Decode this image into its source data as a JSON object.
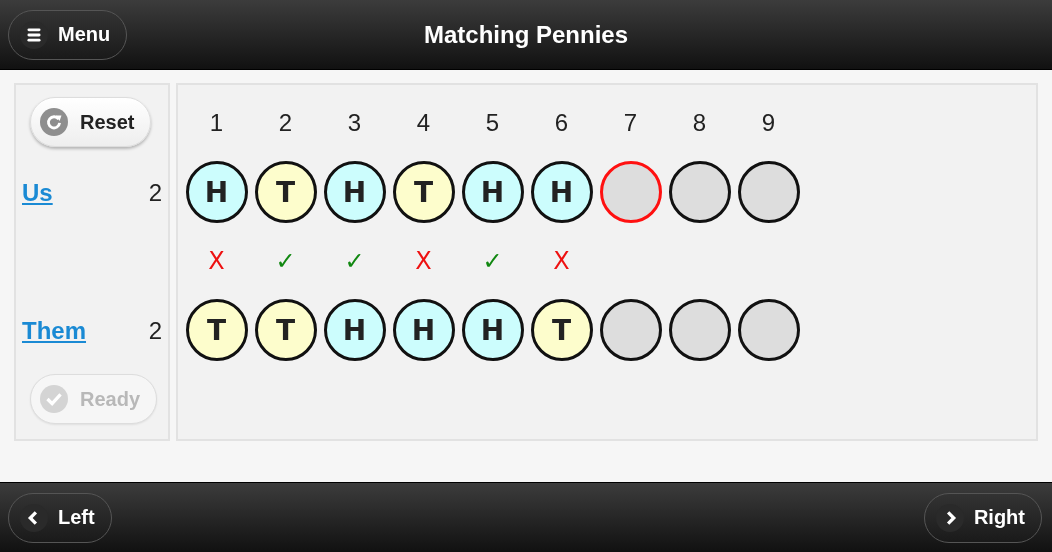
{
  "header": {
    "title": "Matching Pennies",
    "menu_button": "Menu"
  },
  "controls": {
    "reset": "Reset",
    "ready": {
      "label": "Ready",
      "disabled": true
    }
  },
  "players": [
    {
      "name": "Us",
      "score": "2"
    },
    {
      "name": "Them",
      "score": "2"
    }
  ],
  "rounds": [
    "1",
    "2",
    "3",
    "4",
    "5",
    "6",
    "7",
    "8",
    "9"
  ],
  "us_coins": [
    {
      "kind": "heads",
      "face": "H",
      "selected": false
    },
    {
      "kind": "tails",
      "face": "T",
      "selected": false
    },
    {
      "kind": "heads",
      "face": "H",
      "selected": false
    },
    {
      "kind": "tails",
      "face": "T",
      "selected": false
    },
    {
      "kind": "heads",
      "face": "H",
      "selected": false
    },
    {
      "kind": "heads",
      "face": "H",
      "selected": false
    },
    {
      "kind": "empty",
      "selected": true
    },
    {
      "kind": "empty",
      "selected": false
    },
    {
      "kind": "empty",
      "selected": false
    }
  ],
  "results": [
    {
      "kind": "loss",
      "mark": "X"
    },
    {
      "kind": "win",
      "mark": "✓"
    },
    {
      "kind": "win",
      "mark": "✓"
    },
    {
      "kind": "loss",
      "mark": "X"
    },
    {
      "kind": "win",
      "mark": "✓"
    },
    {
      "kind": "loss",
      "mark": "X"
    }
  ],
  "them_coins": [
    {
      "kind": "tails",
      "face": "T"
    },
    {
      "kind": "tails",
      "face": "T"
    },
    {
      "kind": "heads",
      "face": "H"
    },
    {
      "kind": "heads",
      "face": "H"
    },
    {
      "kind": "heads",
      "face": "H"
    },
    {
      "kind": "tails",
      "face": "T"
    },
    {
      "kind": "empty"
    },
    {
      "kind": "empty"
    },
    {
      "kind": "empty"
    }
  ],
  "footer": {
    "left": "Left",
    "right": "Right"
  }
}
